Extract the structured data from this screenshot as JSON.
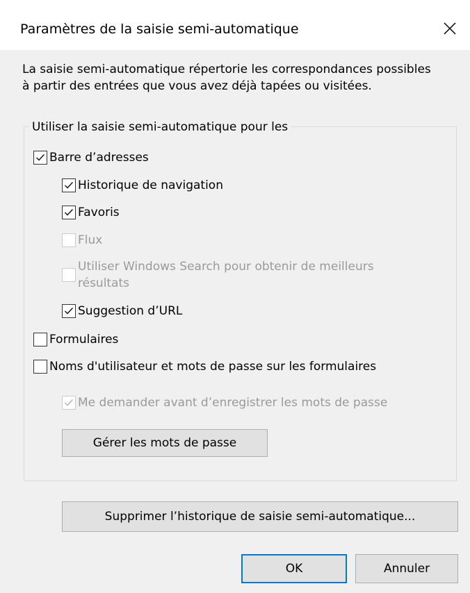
{
  "dialog": {
    "title": "Paramètres de la saisie semi-automatique",
    "close_icon": "close-icon"
  },
  "description": "La saisie semi-automatique répertorie les correspondances possibles à partir des entrées que vous avez déjà tapées ou visitées.",
  "group": {
    "legend": "Utiliser la saisie semi-automatique pour les",
    "items": {
      "address_bar": {
        "label": "Barre d’adresses",
        "checked": true,
        "enabled": true
      },
      "history": {
        "label": "Historique de navigation",
        "checked": true,
        "enabled": true
      },
      "favorites": {
        "label": "Favoris",
        "checked": true,
        "enabled": true
      },
      "feeds": {
        "label": "Flux",
        "checked": false,
        "enabled": false
      },
      "windows_search": {
        "label": "Utiliser Windows Search pour obtenir de meilleurs résultats",
        "checked": false,
        "enabled": false
      },
      "url_suggestion": {
        "label": "Suggestion d’URL",
        "checked": true,
        "enabled": true
      },
      "forms": {
        "label": "Formulaires",
        "checked": false,
        "enabled": true
      },
      "usernames": {
        "label": "Noms d'utilisateur et mots de passe sur les formulaires",
        "checked": false,
        "enabled": true
      },
      "ask_before_save": {
        "label": "Me demander avant d’enregistrer les mots de passe",
        "checked": true,
        "enabled": false
      }
    },
    "manage_passwords_label": "Gérer les mots de passe"
  },
  "delete_history_label": "Supprimer l’historique de saisie semi-automatique...",
  "footer": {
    "ok_label": "OK",
    "cancel_label": "Annuler"
  },
  "colors": {
    "accent": "#0078d7",
    "disabled_text": "#9a9a9a"
  }
}
